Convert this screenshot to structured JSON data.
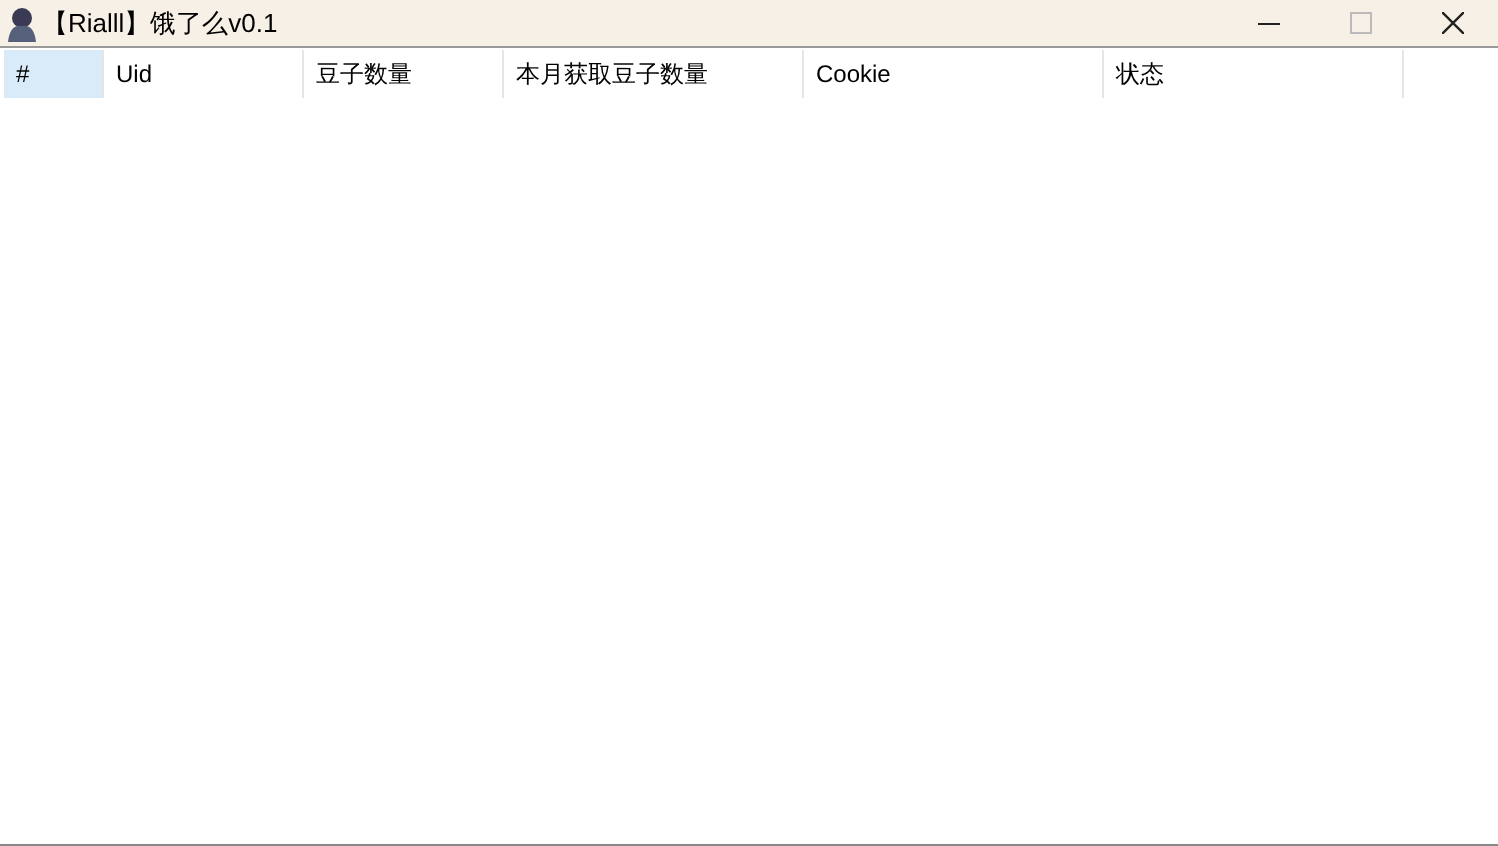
{
  "window": {
    "title": "【Rialll】饿了么v0.1"
  },
  "table": {
    "columns": [
      {
        "label": "#",
        "selected": true
      },
      {
        "label": "Uid",
        "selected": false
      },
      {
        "label": "豆子数量",
        "selected": false
      },
      {
        "label": "本月获取豆子数量",
        "selected": false
      },
      {
        "label": "Cookie",
        "selected": false
      },
      {
        "label": "状态",
        "selected": false
      }
    ]
  }
}
